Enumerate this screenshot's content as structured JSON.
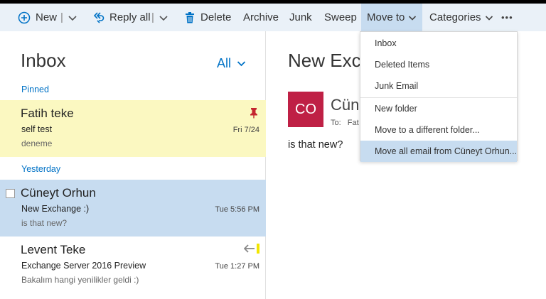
{
  "toolbar": {
    "new_label": "New",
    "reply_all_label": "Reply all",
    "delete_label": "Delete",
    "archive_label": "Archive",
    "junk_label": "Junk",
    "sweep_label": "Sweep",
    "move_to_label": "Move to",
    "categories_label": "Categories",
    "separator": "|",
    "more_label": "•••"
  },
  "list": {
    "title": "Inbox",
    "filter_label": "All",
    "groups": {
      "pinned": "Pinned",
      "yesterday": "Yesterday"
    },
    "messages": [
      {
        "sender": "Fatih teke",
        "subject": "self test",
        "preview": "deneme",
        "date": "Fri 7/24"
      },
      {
        "sender": "Cüneyt Orhun",
        "subject": "New Exchange :)",
        "preview": "is that new?",
        "date": "Tue 5:56 PM"
      },
      {
        "sender": "Levent Teke",
        "subject": "Exchange Server 2016 Preview",
        "preview": "Bakalım hangi yenilikler geldi :)",
        "date": "Tue 1:27 PM"
      }
    ]
  },
  "reading": {
    "subject": "New Exc",
    "avatar_initials": "CO",
    "sender": "Cüne",
    "to_label": "To:",
    "to_value": "Fat",
    "body": "is that new?"
  },
  "move_menu": {
    "items": [
      "Inbox",
      "Deleted Items",
      "Junk Email",
      "New folder",
      "Move to a different folder...",
      "Move all email from Cüneyt Orhun..."
    ]
  },
  "colors": {
    "accent": "#0072c6",
    "toolbar_bg": "#eaf1f8",
    "selected_bg": "#c7dcf0",
    "pinned_bg": "#fbf8c1",
    "avatar_bg": "#bf2045",
    "pin_red": "#c4262e",
    "flag_yellow": "#f2e600"
  },
  "icons": {
    "new": "plus-circle-icon",
    "reply_all": "reply-all-icon",
    "delete": "trash-icon",
    "pin": "pin-icon",
    "replied": "reply-arrow-icon",
    "more": "more-icon"
  }
}
